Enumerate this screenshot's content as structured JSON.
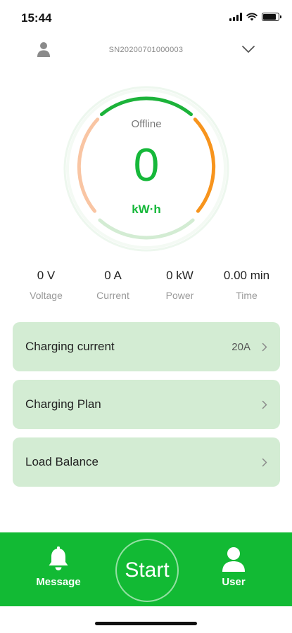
{
  "status_bar": {
    "time": "15:44"
  },
  "header": {
    "serial": "SN20200701000003"
  },
  "gauge": {
    "status": "Offline",
    "value": "0",
    "unit": "kW·h"
  },
  "stats": [
    {
      "value": "0 V",
      "label": "Voltage"
    },
    {
      "value": "0 A",
      "label": "Current"
    },
    {
      "value": "0 kW",
      "label": "Power"
    },
    {
      "value": "0.00 min",
      "label": "Time"
    }
  ],
  "cards": [
    {
      "label": "Charging current",
      "value": "20A"
    },
    {
      "label": "Charging Plan",
      "value": ""
    },
    {
      "label": "Load Balance",
      "value": ""
    }
  ],
  "bottom_bar": {
    "message_label": "Message",
    "start_label": "Start",
    "user_label": "User"
  },
  "colors": {
    "accent": "#12ba34",
    "card_bg": "#d3ecd3",
    "arc_orange": "#f7941d",
    "arc_peach": "#f9c5a3"
  }
}
